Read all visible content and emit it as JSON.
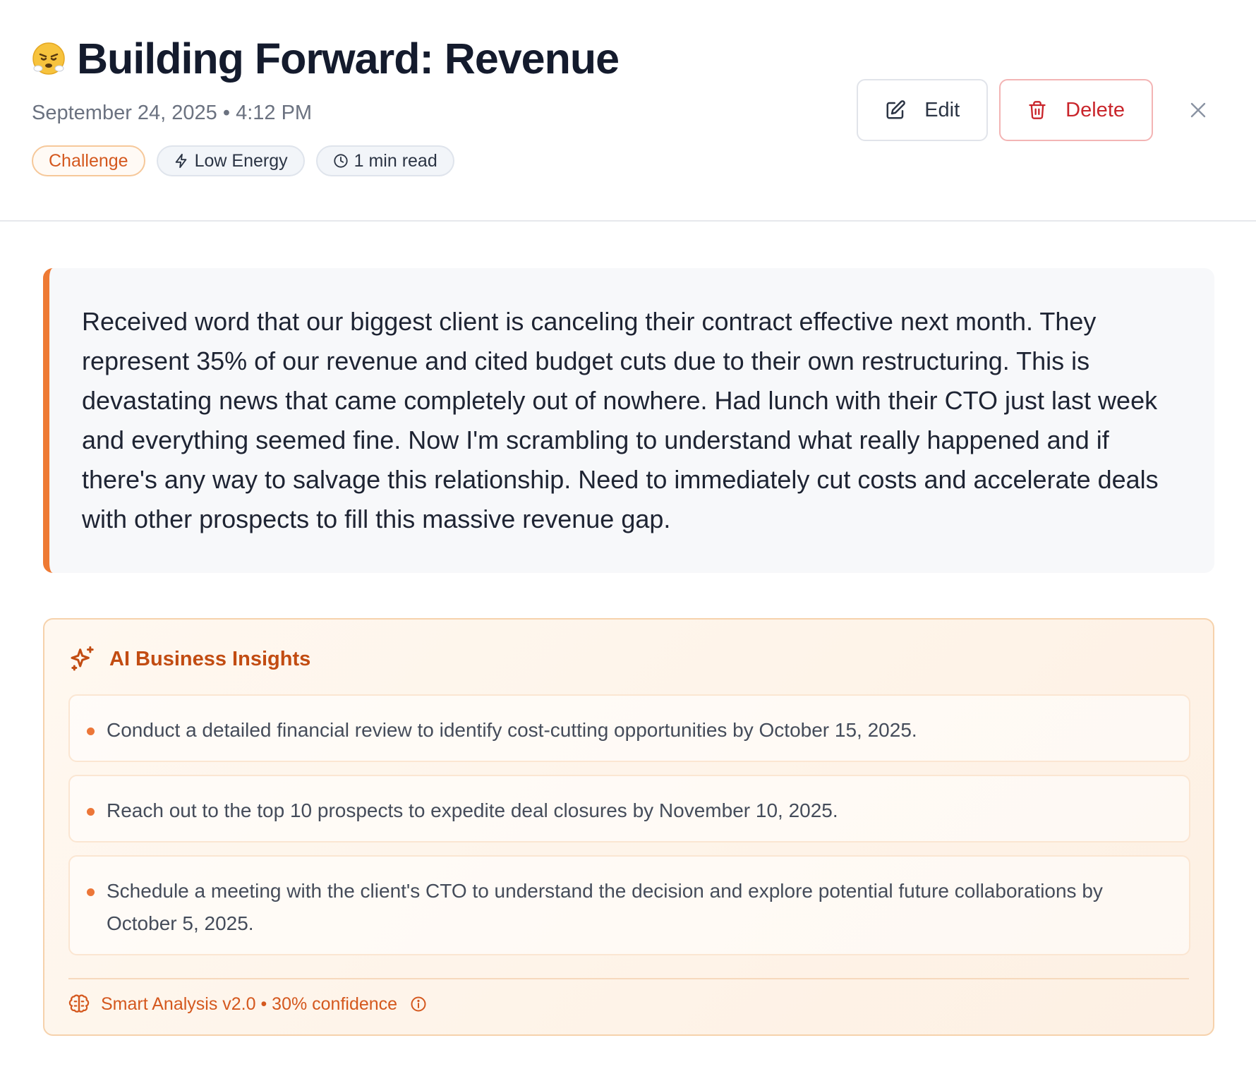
{
  "entry": {
    "title": "Building Forward: Revenue",
    "mood_icon": "frustrated-face-emoji",
    "date": "September 24, 2025",
    "separator": "•",
    "time": "4:12 PM",
    "tags": {
      "category": "Challenge",
      "energy": "Low Energy",
      "read_time": "1 min read"
    },
    "body": "Received word that our biggest client is canceling their contract effective next month. They represent 35% of our revenue and cited budget cuts due to their own restructuring. This is devastating news that came completely out of nowhere. Had lunch with their CTO just last week and everything seemed fine. Now I'm scrambling to understand what really happened and if there's any way to salvage this relationship. Need to immediately cut costs and accelerate deals with other prospects to fill this massive revenue gap."
  },
  "actions": {
    "edit_label": "Edit",
    "delete_label": "Delete"
  },
  "insights": {
    "title": "AI Business Insights",
    "items": [
      "Conduct a detailed financial review to identify cost-cutting opportunities by October 15, 2025.",
      "Reach out to the top 10 prospects to expedite deal closures by November 10, 2025.",
      "Schedule a meeting with the client's CTO to understand the decision and explore potential future collaborations by October 5, 2025."
    ],
    "footer": "Smart Analysis v2.0 • 30% confidence"
  },
  "colors": {
    "accent_orange": "#ee7a34",
    "insight_title": "#c24c12",
    "delete_red": "#c9252b"
  }
}
